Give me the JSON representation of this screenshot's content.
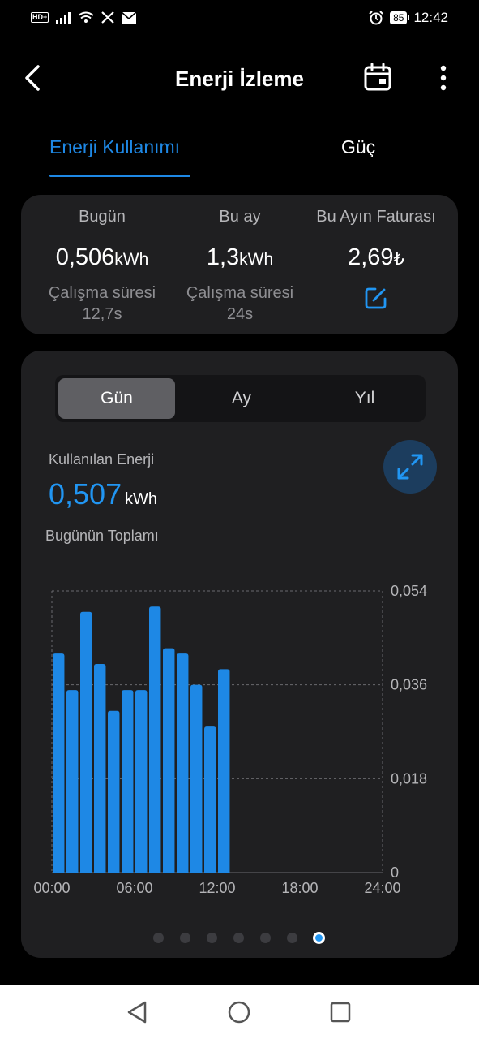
{
  "status": {
    "time": "12:42",
    "battery": "85",
    "hd": "HD+"
  },
  "header": {
    "title": "Enerji İzleme"
  },
  "tabs": {
    "energy": "Enerji Kullanımı",
    "power": "Güç"
  },
  "summary": {
    "today": {
      "label": "Bugün",
      "value": "0,506",
      "unit": "kWh",
      "sub_label": "Çalışma süresi",
      "sub_value": "12,7s"
    },
    "month": {
      "label": "Bu ay",
      "value": "1,3",
      "unit": "kWh",
      "sub_label": "Çalışma süresi",
      "sub_value": "24s"
    },
    "bill": {
      "label": "Bu Ayın Faturası",
      "value": "2,69",
      "unit": "₺"
    }
  },
  "segment": {
    "day": "Gün",
    "month": "Ay",
    "year": "Yıl",
    "selected": "Gün"
  },
  "energy": {
    "label": "Kullanılan Enerji",
    "value": "0,507",
    "unit": "kWh",
    "total_label": "Bugünün Toplamı"
  },
  "chart_data": {
    "type": "bar",
    "x": [
      "00:00",
      "01:00",
      "02:00",
      "03:00",
      "04:00",
      "05:00",
      "06:00",
      "07:00",
      "08:00",
      "09:00",
      "10:00",
      "11:00",
      "12:00"
    ],
    "values": [
      0.042,
      0.035,
      0.05,
      0.04,
      0.031,
      0.035,
      0.035,
      0.051,
      0.043,
      0.042,
      0.036,
      0.028,
      0.039
    ],
    "xticks": [
      "00:00",
      "06:00",
      "12:00",
      "18:00",
      "24:00"
    ],
    "yticks": [
      "0",
      "0,018",
      "0,036",
      "0,054"
    ],
    "ylim": [
      0,
      0.054
    ],
    "xlim": [
      0,
      24
    ],
    "grid": true,
    "color": "#1e88e5"
  },
  "pager": {
    "count": 7,
    "active": 6
  },
  "colors": {
    "accent": "#1e88e5",
    "card": "#1f1f21",
    "background": "#000000"
  }
}
